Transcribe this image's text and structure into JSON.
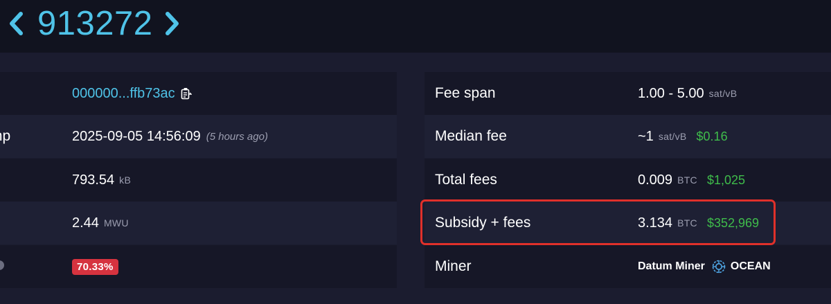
{
  "header": {
    "block_height": "913272",
    "prev_icon": "chevron-left-icon",
    "next_icon": "chevron-right-icon"
  },
  "left_panel": {
    "rows": [
      {
        "label": "",
        "value": "000000...ffb73ac",
        "icon": "copy-icon"
      },
      {
        "label": "mp",
        "value": "2025-09-05 14:56:09",
        "relative": "(5 hours ago)"
      },
      {
        "label": "",
        "value": "793.54",
        "unit": "kB"
      },
      {
        "label": "",
        "value": "2.44",
        "unit": "MWU"
      },
      {
        "label": "",
        "badge": "70.33%",
        "icon": "info-icon"
      }
    ]
  },
  "right_panel": {
    "rows": [
      {
        "label": "Fee span",
        "value": "1.00 - 5.00",
        "unit": "sat/vB"
      },
      {
        "label": "Median fee",
        "value": "~1",
        "unit": "sat/vB",
        "fiat": "$0.16"
      },
      {
        "label": "Total fees",
        "value": "0.009",
        "unit": "BTC",
        "fiat": "$1,025"
      },
      {
        "label": "Subsidy + fees",
        "value": "3.134",
        "unit": "BTC",
        "fiat": "$352,969"
      },
      {
        "label": "Miner",
        "miner_name": "Datum Miner",
        "pool": "OCEAN",
        "icon": "ocean-pool-icon"
      }
    ]
  },
  "colors": {
    "accent": "#4fc3e8",
    "fiat": "#3fbc4b",
    "badge": "#d6333f",
    "highlight": "#e0302a",
    "background": "#1b1c2f"
  }
}
